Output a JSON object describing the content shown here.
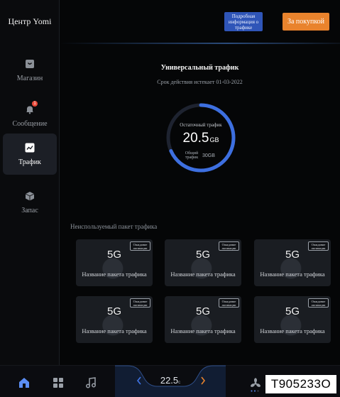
{
  "app": {
    "title": "Центр Yomi"
  },
  "sidebar": {
    "items": [
      {
        "label": "Магазин",
        "icon": "bag-icon",
        "active": false
      },
      {
        "label": "Сообщение",
        "icon": "bell-icon",
        "active": false,
        "badge": "1"
      },
      {
        "label": "Трафик",
        "icon": "chart-line-icon",
        "active": true
      },
      {
        "label": "Запас",
        "icon": "cube-icon",
        "active": false
      }
    ]
  },
  "header": {
    "info_button": "Подробная информация о трафике",
    "buy_button": "За покупкой"
  },
  "traffic": {
    "title": "Универсальный трафик",
    "expiry": "Срок действия истекает 01-03-2022",
    "remaining_label": "Остаточный трафик",
    "remaining_value": "20.5",
    "remaining_unit": "GB",
    "total_label": "Общий трафик",
    "total_value": "30GB",
    "remaining_fraction": 0.683,
    "colors": {
      "ring": "#3d6fe0",
      "track": "#1e2330"
    }
  },
  "packages": {
    "section_title": "Неиспользуемый пакет трафика",
    "items": [
      {
        "type": "5G",
        "badge": "Ожидание активации",
        "name": "Название пакета трафика"
      },
      {
        "type": "5G",
        "badge": "Ожидание активации",
        "name": "Название пакета трафика"
      },
      {
        "type": "5G",
        "badge": "Ожидание активации",
        "name": "Название пакета трафика"
      },
      {
        "type": "5G",
        "badge": "Ожидание активации",
        "name": "Название пакета трафика"
      },
      {
        "type": "5G",
        "badge": "Ожидание активации",
        "name": "Название пакета трафика"
      },
      {
        "type": "5G",
        "badge": "Ожидание активации",
        "name": "Название пакета трафика"
      }
    ]
  },
  "bottom_bar": {
    "home_icon": "home-icon",
    "apps_icon": "apps-grid-icon",
    "music_icon": "music-note-icon",
    "temperature": "22.5",
    "temperature_unit": "c",
    "fan_icon": "fan-icon",
    "code": "T905233O"
  }
}
